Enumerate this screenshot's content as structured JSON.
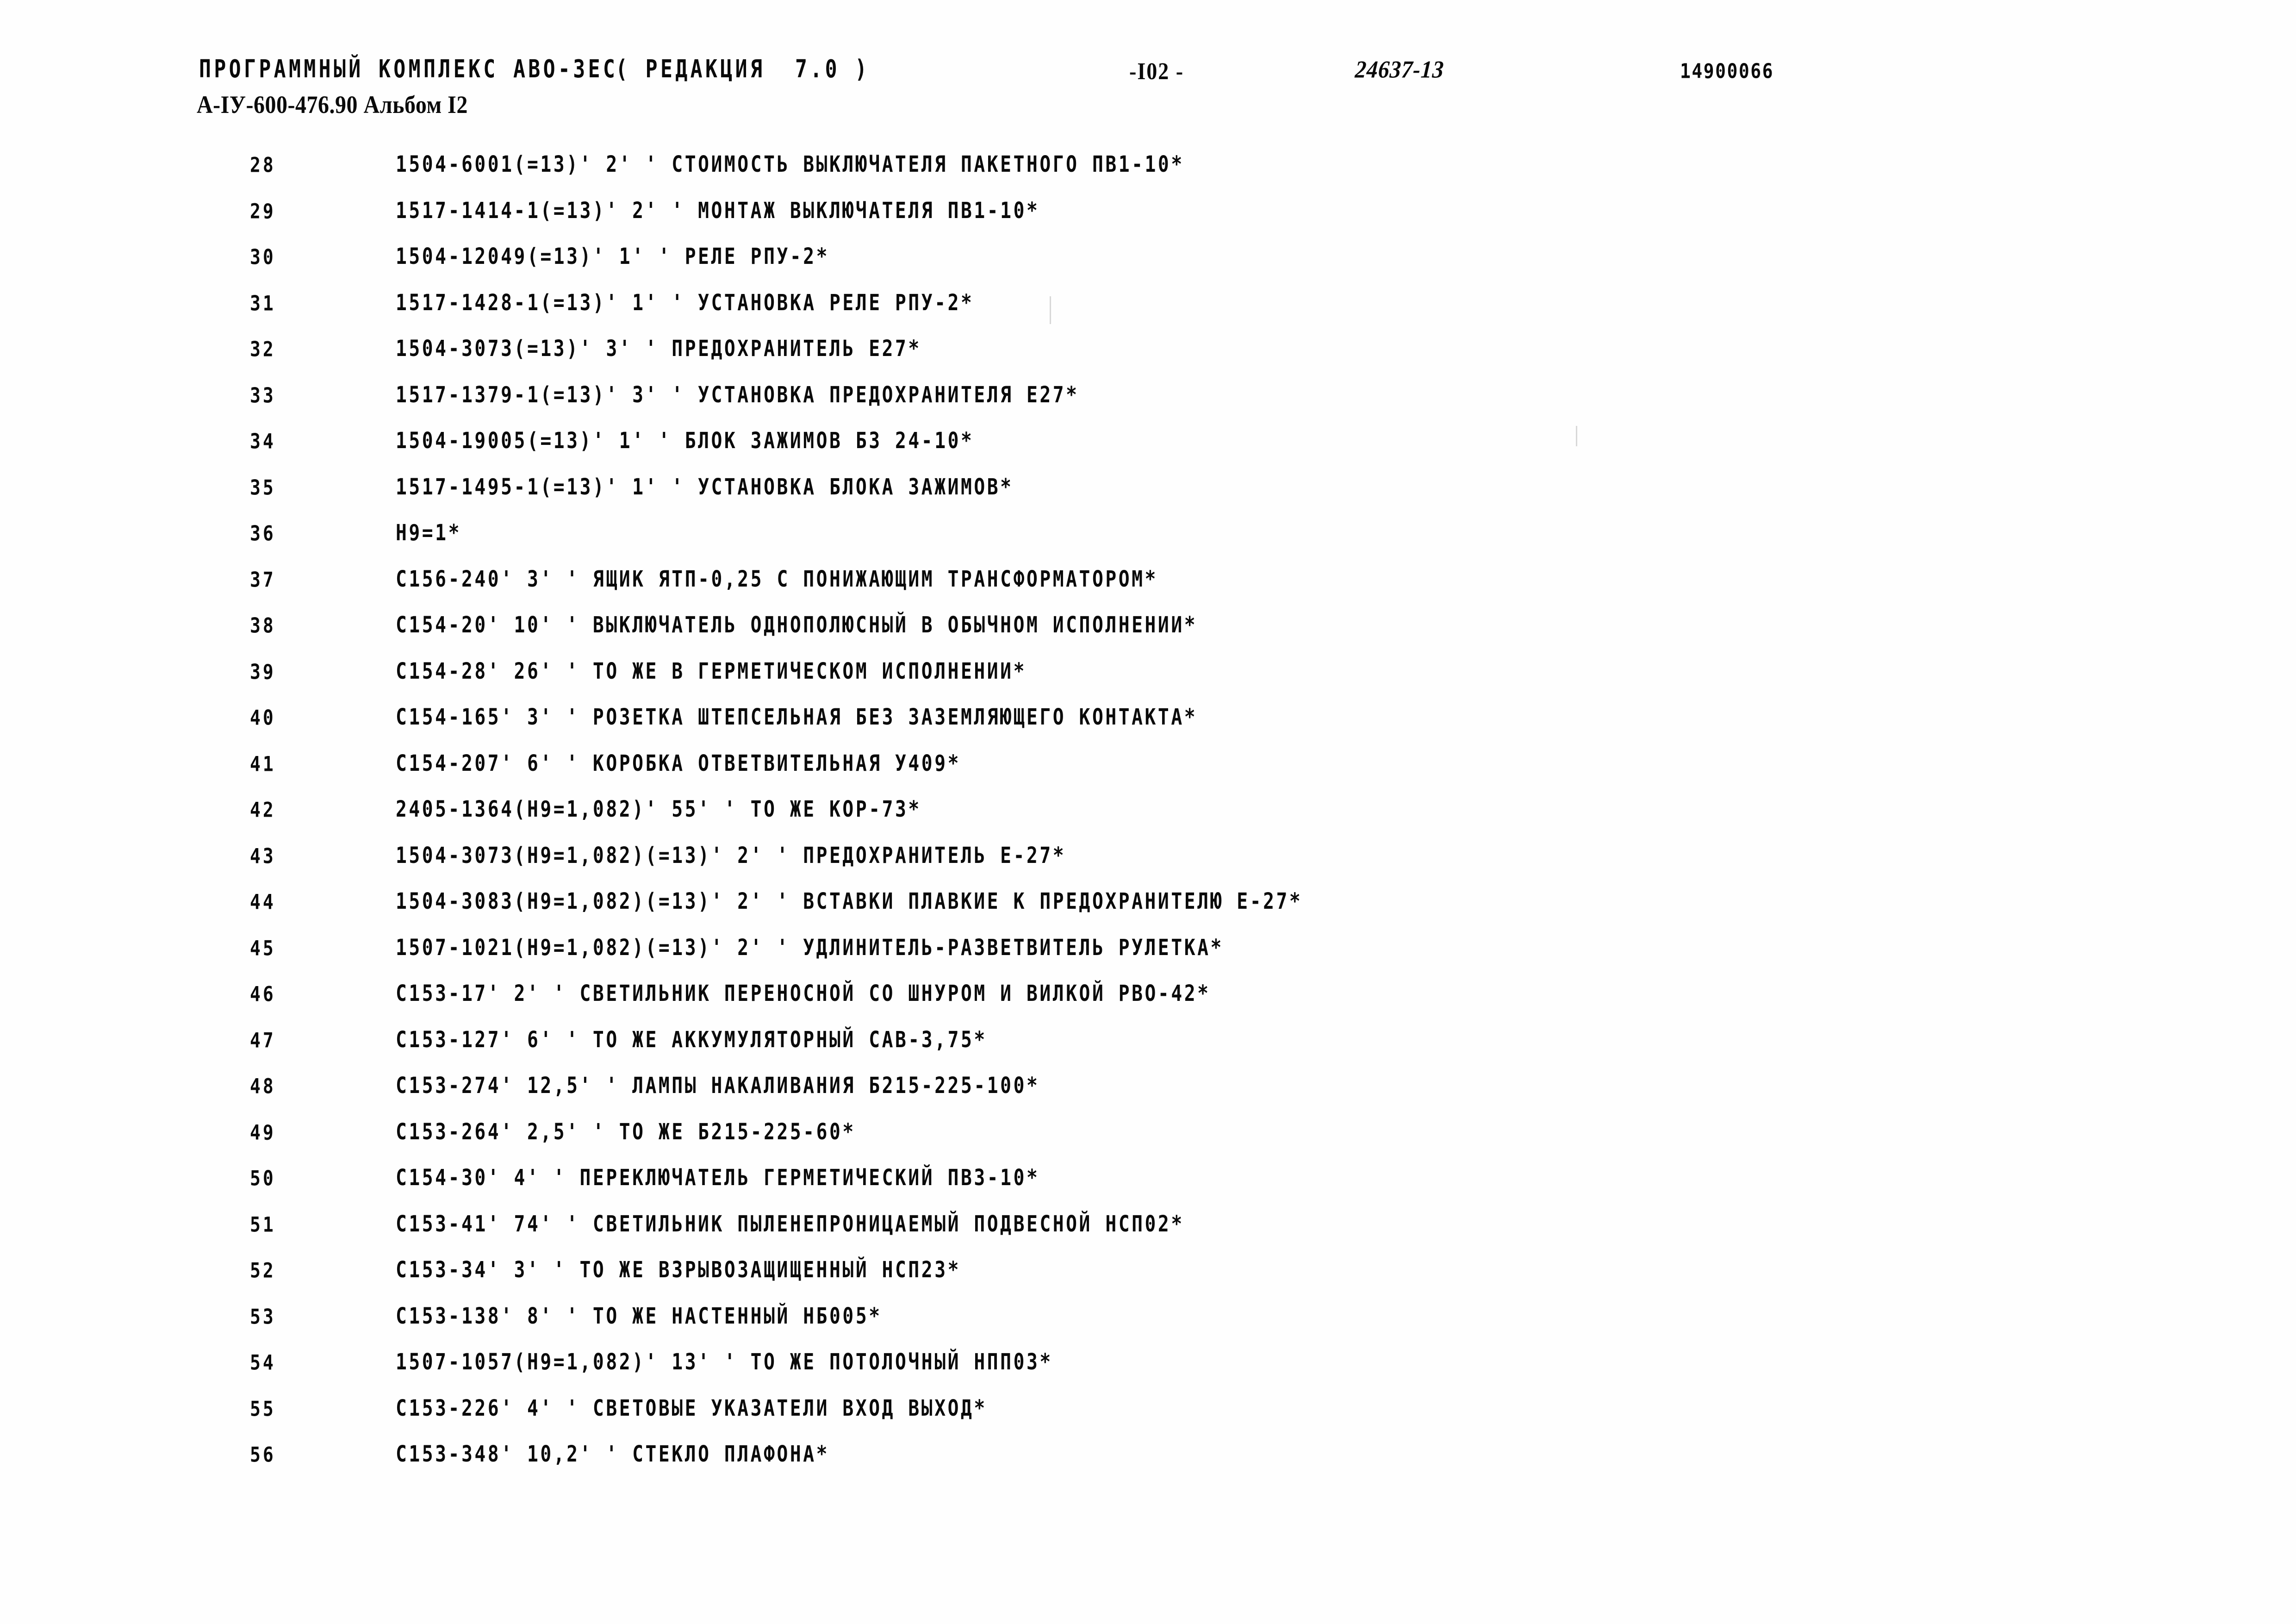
{
  "header": {
    "program_complex": "ПРОГРАММНЫЙ КОМПЛЕКС АВО-ЗЕС",
    "revision": "( РЕДАКЦИЯ  7.0 )",
    "page_number": "-I02 -",
    "order_code": "24637-13",
    "serial_number": "14900066",
    "document_code": "А-IУ-600-476.90 Альбом I2"
  },
  "listing": {
    "rows": [
      {
        "num": "28",
        "text": "1504-6001(=13)' 2' ' СТОИМОСТЬ ВЫКЛЮЧАТЕЛЯ ПАКЕТНОГО ПВ1-10*"
      },
      {
        "num": "29",
        "text": "1517-1414-1(=13)' 2' ' МОНТАЖ ВЫКЛЮЧАТЕЛЯ ПВ1-10*"
      },
      {
        "num": "30",
        "text": "1504-12049(=13)' 1' ' РЕЛЕ РПУ-2*"
      },
      {
        "num": "31",
        "text": "1517-1428-1(=13)' 1' ' УСТАНОВКА РЕЛЕ РПУ-2*"
      },
      {
        "num": "32",
        "text": "1504-3073(=13)' 3' ' ПРЕДОХРАНИТЕЛЬ Е27*"
      },
      {
        "num": "33",
        "text": "1517-1379-1(=13)' 3' ' УСТАНОВКА ПРЕДОХРАНИТЕЛЯ Е27*"
      },
      {
        "num": "34",
        "text": "1504-19005(=13)' 1' ' БЛОК ЗАЖИМОВ БЗ 24-10*"
      },
      {
        "num": "35",
        "text": "1517-1495-1(=13)' 1' ' УСТАНОВКА БЛОКА ЗАЖИМОВ*"
      },
      {
        "num": "36",
        "text": "Н9=1*"
      },
      {
        "num": "37",
        "text": "С156-240' 3' ' ЯЩИК ЯТП-0,25 С ПОНИЖАЮЩИМ ТРАНСФОРМАТОРОМ*"
      },
      {
        "num": "38",
        "text": "С154-20' 10' ' ВЫКЛЮЧАТЕЛЬ ОДНОПОЛЮСНЫЙ В ОБЫЧНОМ ИСПОЛНЕНИИ*"
      },
      {
        "num": "39",
        "text": "С154-28' 26' ' ТО ЖЕ В ГЕРМЕТИЧЕСКОМ ИСПОЛНЕНИИ*"
      },
      {
        "num": "40",
        "text": "С154-165' 3' ' РОЗЕТКА ШТЕПСЕЛЬНАЯ БЕЗ ЗАЗЕМЛЯЮЩЕГО КОНТАКТА*"
      },
      {
        "num": "41",
        "text": "С154-207' 6' ' КОРОБКА ОТВЕТВИТЕЛЬНАЯ У409*"
      },
      {
        "num": "42",
        "text": "2405-1364(Н9=1,082)' 55' ' ТО ЖЕ КОР-73*"
      },
      {
        "num": "43",
        "text": "1504-3073(Н9=1,082)(=13)' 2' ' ПРЕДОХРАНИТЕЛЬ Е-27*"
      },
      {
        "num": "44",
        "text": "1504-3083(Н9=1,082)(=13)' 2' ' ВСТАВКИ ПЛАВКИЕ К ПРЕДОХРАНИТЕЛЮ Е-27*"
      },
      {
        "num": "45",
        "text": "1507-1021(Н9=1,082)(=13)' 2' ' УДЛИНИТЕЛЬ-РАЗВЕТВИТЕЛЬ РУЛЕТКА*"
      },
      {
        "num": "46",
        "text": "С153-17' 2' ' СВЕТИЛЬНИК ПЕРЕНОСНОЙ СО ШНУРОМ И ВИЛКОЙ РВО-42*"
      },
      {
        "num": "47",
        "text": "С153-127' 6' ' ТО ЖЕ АККУМУЛЯТОРНЫЙ САВ-3,75*"
      },
      {
        "num": "48",
        "text": "С153-274' 12,5' ' ЛАМПЫ НАКАЛИВАНИЯ Б215-225-100*"
      },
      {
        "num": "49",
        "text": "С153-264' 2,5' ' ТО ЖЕ Б215-225-60*"
      },
      {
        "num": "50",
        "text": "С154-30' 4' ' ПЕРЕКЛЮЧАТЕЛЬ ГЕРМЕТИЧЕСКИЙ ПВ3-10*"
      },
      {
        "num": "51",
        "text": "С153-41' 74' ' СВЕТИЛЬНИК ПЫЛЕНЕПРОНИЦАЕМЫЙ ПОДВЕСНОЙ НСП02*"
      },
      {
        "num": "52",
        "text": "С153-34' 3' ' ТО ЖЕ ВЗРЫВОЗАЩИЩЕННЫЙ НСП23*"
      },
      {
        "num": "53",
        "text": "С153-138' 8' ' ТО ЖЕ НАСТЕННЫЙ НБ005*"
      },
      {
        "num": "54",
        "text": "1507-1057(Н9=1,082)' 13' ' ТО ЖЕ ПОТОЛОЧНЫЙ НПП03*"
      },
      {
        "num": "55",
        "text": "С153-226' 4' ' СВЕТОВЫЕ УКАЗАТЕЛИ ВХОД ВЫХОД*"
      },
      {
        "num": "56",
        "text": "С153-348' 10,2' ' СТЕКЛО ПЛАФОНА*"
      }
    ]
  }
}
